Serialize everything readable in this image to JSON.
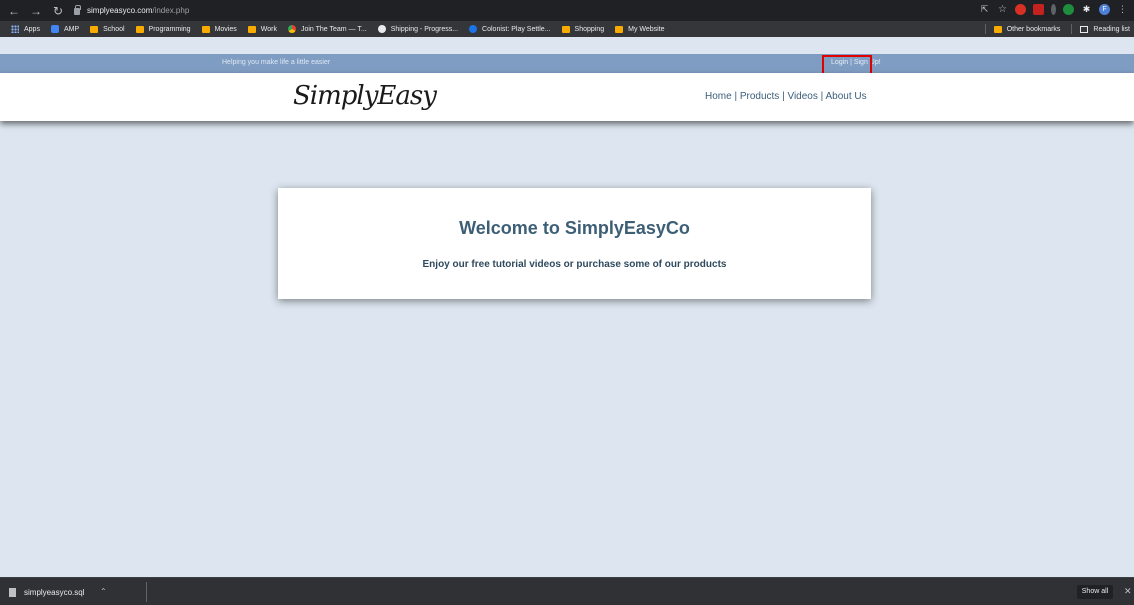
{
  "browser": {
    "host": "simplyeasyco.com",
    "path": "/index.php",
    "bookmarks": [
      {
        "label": "Apps",
        "icon": "apps-icon"
      },
      {
        "label": "AMP",
        "icon": "amp-icon"
      },
      {
        "label": "School",
        "icon": "folder-icon"
      },
      {
        "label": "Programming",
        "icon": "folder-icon"
      },
      {
        "label": "Movies",
        "icon": "folder-icon"
      },
      {
        "label": "Work",
        "icon": "folder-icon"
      },
      {
        "label": "Join The Team — T...",
        "icon": "chrome-icon"
      },
      {
        "label": "Shipping - Progress...",
        "icon": "globe-icon"
      },
      {
        "label": "Colonist: Play Settle...",
        "icon": "colonist-icon"
      },
      {
        "label": "Shopping",
        "icon": "folder-icon"
      },
      {
        "label": "My Website",
        "icon": "folder-icon"
      }
    ],
    "other_bookmarks": "Other bookmarks",
    "reading_list": "Reading list"
  },
  "site": {
    "tagline": "Helping you make life a little easier",
    "auth_link": "Login | Sign Up!",
    "logo": "SimplyEasy",
    "nav": {
      "home": "Home",
      "products": "Products",
      "videos": "Videos",
      "about": "About Us",
      "separator": " | "
    },
    "welcome_title": "Welcome to SimplyEasyCo",
    "welcome_sub": "Enjoy our free tutorial videos or purchase some of our products"
  },
  "download_bar": {
    "file": "simplyeasyco.sql",
    "show_all": "Show all"
  },
  "colors": {
    "topbar": "#7f9dc3",
    "page_bg": "#dde6f0",
    "highlight": "#e00000",
    "title": "#3d5f76"
  }
}
